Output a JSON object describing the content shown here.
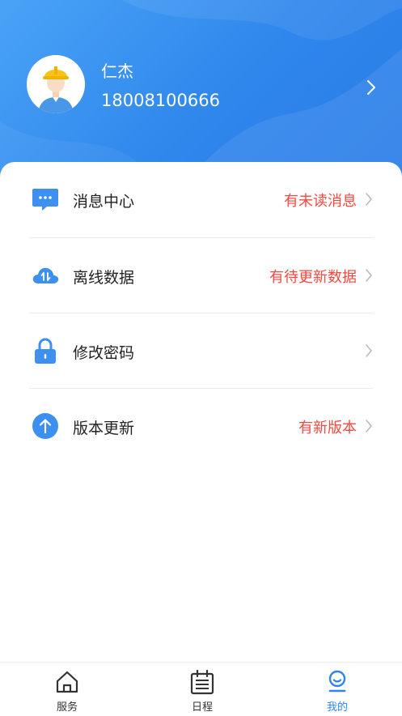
{
  "profile": {
    "name": "仁杰",
    "phone": "18008100666"
  },
  "menu": [
    {
      "label": "消息中心",
      "status": "有未读消息",
      "icon": "message-icon"
    },
    {
      "label": "离线数据",
      "status": "有待更新数据",
      "icon": "cloud-sync-icon"
    },
    {
      "label": "修改密码",
      "status": "",
      "icon": "lock-icon"
    },
    {
      "label": "版本更新",
      "status": "有新版本",
      "icon": "upload-arrow-icon"
    }
  ],
  "tabs": [
    {
      "label": "服务",
      "icon": "home-icon",
      "active": false
    },
    {
      "label": "日程",
      "icon": "calendar-icon",
      "active": false
    },
    {
      "label": "我的",
      "icon": "profile-icon",
      "active": true
    }
  ],
  "colors": {
    "accent": "#2e86ec",
    "status_red": "#f24a40"
  }
}
